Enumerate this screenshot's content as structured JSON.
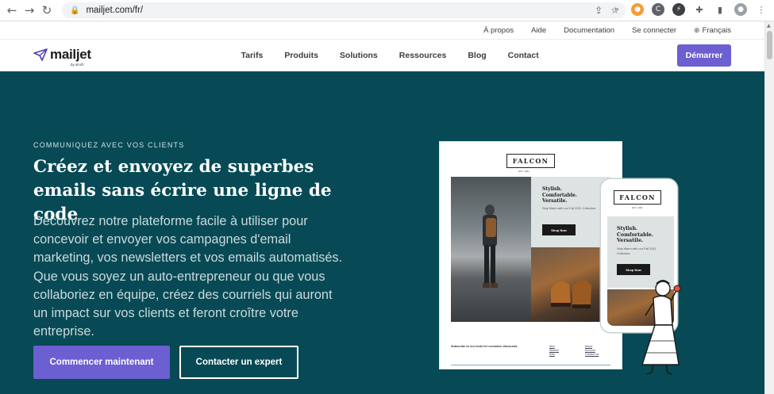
{
  "browser": {
    "url": "mailjet.com/fr/",
    "back_icon": "←",
    "forward_icon": "→",
    "reload_icon": "↻"
  },
  "topbar": {
    "links": [
      "À propos",
      "Aide",
      "Documentation",
      "Se connecter"
    ],
    "language": "Français"
  },
  "nav": {
    "logo": "mailjet",
    "logo_sub": "by sinch",
    "items": [
      "Tarifs",
      "Produits",
      "Solutions",
      "Ressources",
      "Blog",
      "Contact"
    ],
    "cta": "Démarrer"
  },
  "hero": {
    "eyebrow": "COMMUNIQUEZ AVEC VOS CLIENTS",
    "title": "Créez et envoyez de superbes emails sans écrire une ligne de code",
    "description": "Découvrez notre plateforme facile à utiliser pour concevoir et envoyer vos campagnes d'email marketing, vos newsletters et vos emails automatisés. Que vous soyez un auto-entrepreneur ou que vous collaboriez en équipe, créez des courriels qui auront un impact sur vos clients et feront croître votre entreprise.",
    "primary_button": "Commencer maintenant",
    "secondary_button": "Contacter un expert"
  },
  "email_preview": {
    "brand": "FALCON",
    "brand_sub": "EST. 1961",
    "headline": "Stylish.\nComfortable.\nVersatile.",
    "subtext": "Stay Warm with our Fall 2021 Collection",
    "button": "Shop Now",
    "footer_text": "Subscribe to our texts for exclusive discounts.",
    "footer_col1": [
      "Men",
      "Women",
      "Kids"
    ],
    "footer_col2": [
      "About",
      "Account",
      "Contact Us"
    ]
  },
  "colors": {
    "accent": "#6b5fd1",
    "hero_bg": "#074a55"
  }
}
